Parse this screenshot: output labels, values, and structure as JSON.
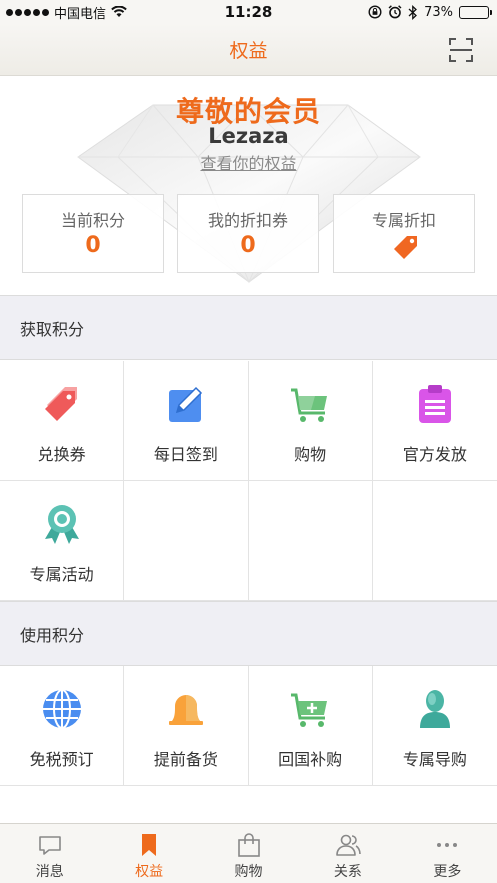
{
  "status_bar": {
    "carrier": "中国电信",
    "time": "11:28",
    "battery_text": "73%",
    "battery_level": 0.73
  },
  "header": {
    "title": "权益",
    "scan_icon": "scan-icon"
  },
  "hero": {
    "title": "尊敬的会员",
    "username": "Lezaza",
    "view_link": "查看你的权益",
    "stats": [
      {
        "label": "当前积分",
        "value": "0"
      },
      {
        "label": "我的折扣券",
        "value": "0"
      },
      {
        "label": "专属折扣",
        "icon": "tag-icon"
      }
    ]
  },
  "earn": {
    "section_title": "获取积分",
    "items": [
      {
        "label": "兑换券",
        "icon": "coupon-tag-icon"
      },
      {
        "label": "每日签到",
        "icon": "edit-pencil-icon"
      },
      {
        "label": "购物",
        "icon": "shopping-cart-icon"
      },
      {
        "label": "官方发放",
        "icon": "clipboard-icon"
      },
      {
        "label": "专属活动",
        "icon": "award-ribbon-icon"
      }
    ]
  },
  "use": {
    "section_title": "使用积分",
    "items": [
      {
        "label": "免税预订",
        "icon": "globe-icon"
      },
      {
        "label": "提前备货",
        "icon": "bell-icon"
      },
      {
        "label": "回国补购",
        "icon": "cart-add-icon"
      },
      {
        "label": "专属导购",
        "icon": "shopping-guide-person-icon"
      }
    ]
  },
  "tab_bar": {
    "tabs": [
      {
        "label": "消息",
        "icon": "message-icon"
      },
      {
        "label": "权益",
        "icon": "bookmark-icon",
        "active": true
      },
      {
        "label": "购物",
        "icon": "shopping-bag-icon"
      },
      {
        "label": "关系",
        "icon": "contacts-icon"
      },
      {
        "label": "更多",
        "icon": "more-dots-icon"
      }
    ]
  },
  "colors": {
    "accent": "#ee6a1c",
    "section_bg": "#efeff4"
  }
}
